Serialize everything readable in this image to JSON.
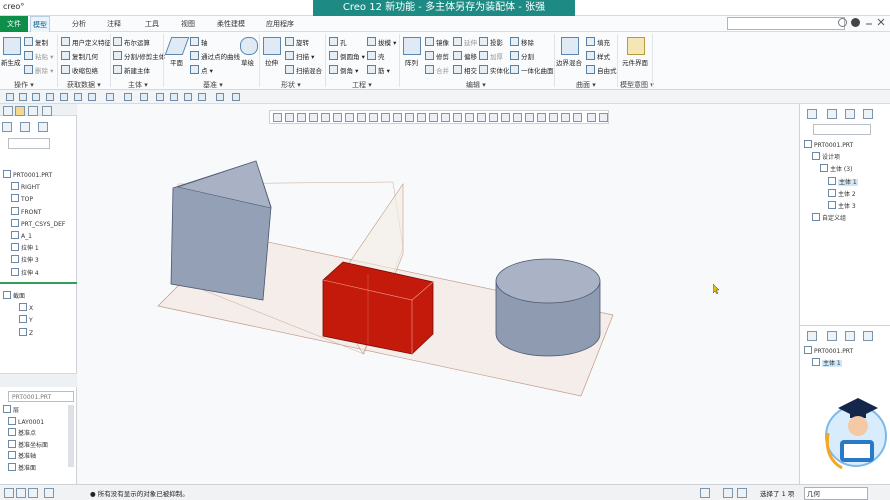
{
  "app": {
    "brand": "creo°",
    "title": "Creo 12 新功能 - 多主体另存为装配体 - 张强"
  },
  "tabs": [
    "文件",
    "模型",
    "分析",
    "注释",
    "工具",
    "视图",
    "柔性建模",
    "应用程序"
  ],
  "active_tab": "模型",
  "ribbon": {
    "groups": [
      {
        "label": "操作 ▾",
        "commands": [
          "复制",
          "粘贴 ▾",
          "删除 ▾",
          "新生成"
        ]
      },
      {
        "label": "获取数据 ▾",
        "commands": [
          "用户定义特征",
          "复制几何",
          "收缩包络"
        ]
      },
      {
        "label": "主体 ▾",
        "commands": [
          "布尔运算",
          "分割/修剪主体",
          "新建主体"
        ]
      },
      {
        "label": "基准 ▾",
        "commands": [
          "平面",
          "轴",
          "通过点的曲线",
          "点 ▾",
          "草绘"
        ]
      },
      {
        "label": "形状 ▾",
        "commands": [
          "拉伸",
          "旋转",
          "扫描 ▾",
          "扫描混合"
        ]
      },
      {
        "label": "工程 ▾",
        "commands": [
          "孔",
          "倒圆角 ▾",
          "倒角 ▾",
          "拔模 ▾",
          "壳",
          "筋 ▾"
        ]
      },
      {
        "label": "编辑 ▾",
        "commands": [
          "阵列",
          "镜像",
          "修剪",
          "合并",
          "延伸",
          "偏移",
          "相交",
          "投影",
          "加厚",
          "实体化",
          "移除",
          "分割",
          "一体化曲面"
        ]
      },
      {
        "label": "曲面 ▾",
        "commands": [
          "边界混合",
          "填充",
          "样式",
          "自由式"
        ]
      },
      {
        "label": "模型意图 ▾",
        "commands": [
          "元件界面"
        ]
      }
    ]
  },
  "left_tree": [
    {
      "label": "PRT0001.PRT",
      "indent": 0,
      "highlight": false
    },
    {
      "label": "RIGHT",
      "indent": 1,
      "highlight": false
    },
    {
      "label": "TOP",
      "indent": 1,
      "highlight": false
    },
    {
      "label": "FRONT",
      "indent": 1,
      "highlight": false
    },
    {
      "label": "PRT_CSYS_DEF",
      "indent": 1,
      "highlight": false
    },
    {
      "label": "A_1",
      "indent": 1,
      "highlight": false
    },
    {
      "label": "拉伸 1",
      "indent": 1,
      "highlight": false
    },
    {
      "label": "拉伸 3",
      "indent": 1,
      "highlight": false
    },
    {
      "label": "拉伸 4",
      "indent": 1,
      "highlight": false
    }
  ],
  "left_tree2": [
    {
      "label": "截面",
      "indent": 0
    },
    {
      "label": "X",
      "indent": 2
    },
    {
      "label": "Y",
      "indent": 2
    },
    {
      "label": "Z",
      "indent": 2
    }
  ],
  "layer_panel": {
    "select": "PRT0001.PRT",
    "items": [
      "层",
      "LAY0001",
      "基准点",
      "基准坐标面",
      "基准轴",
      "基准面"
    ]
  },
  "right_tree": [
    {
      "label": "PRT0001.PRT",
      "indent": 0,
      "highlight": false
    },
    {
      "label": "设计项",
      "indent": 1,
      "highlight": false
    },
    {
      "label": "主体 (3)",
      "indent": 2,
      "highlight": false
    },
    {
      "label": "主体 1",
      "indent": 3,
      "highlight": true
    },
    {
      "label": "主体 2",
      "indent": 3,
      "highlight": false
    },
    {
      "label": "主体 3",
      "indent": 3,
      "highlight": false
    },
    {
      "label": "自定义组",
      "indent": 1,
      "highlight": false
    }
  ],
  "right_tree2": [
    {
      "label": "PRT0001.PRT",
      "indent": 0,
      "highlight": false
    },
    {
      "label": "主体 1",
      "indent": 1,
      "highlight": true
    }
  ],
  "status": {
    "message": "● 所有没有显示的对象已被抑制。",
    "selection": "选择了 1 项",
    "filter": "几何"
  },
  "colors": {
    "title_bg": "#1e8a84",
    "file_tab": "#0d8f4a",
    "red_body": "#c41a0c",
    "grey_body": "#8f9bb0"
  }
}
